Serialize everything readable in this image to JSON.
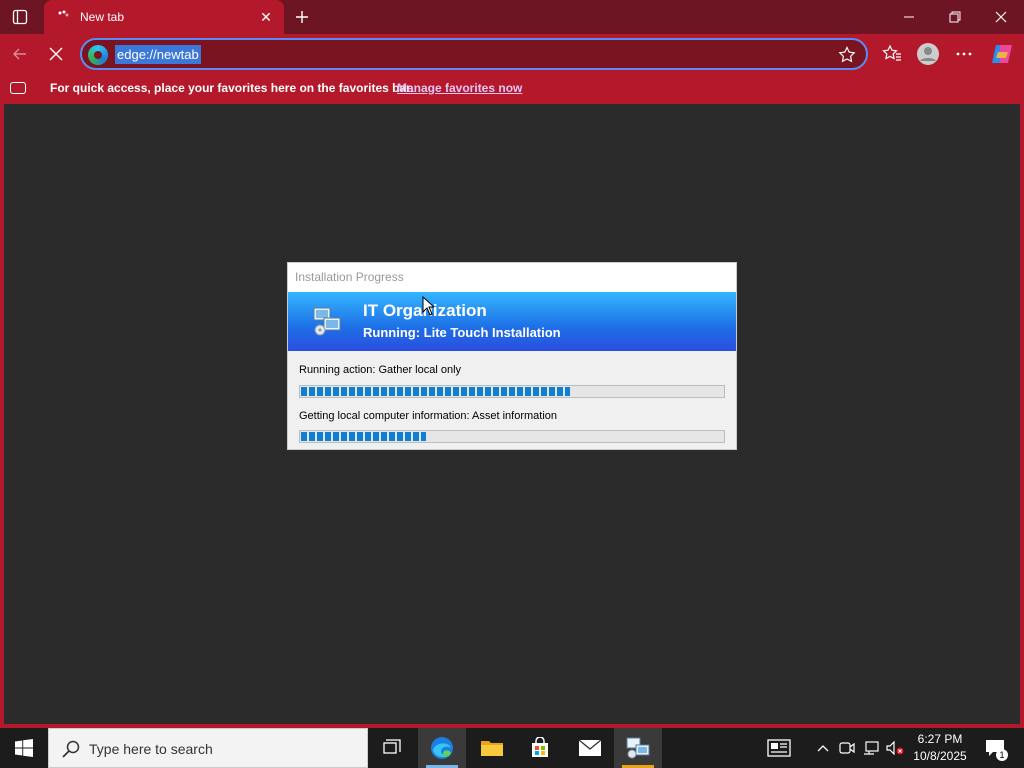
{
  "browser": {
    "tab": {
      "title": "New tab"
    },
    "address": {
      "url": "edge://newtab"
    },
    "favorites_bar": {
      "message": "For quick access, place your favorites here on the favorites bar.",
      "link": "Manage favorites now"
    },
    "theme_color": "#b3192a"
  },
  "dialog": {
    "title": "Installation Progress",
    "organization": "IT Organization",
    "subtitle": "Running: Lite Touch Installation",
    "action_label": "Running action: Gather local only",
    "action_progress_pct": 64,
    "detail_label": "Getting local computer information: Asset information",
    "detail_progress_pct": 30
  },
  "taskbar": {
    "search_placeholder": "Type here to search",
    "time": "6:27 PM",
    "date": "10/8/2025",
    "notification_count": "1",
    "apps": [
      "task-view-icon",
      "edge-icon",
      "file-explorer-icon",
      "store-icon",
      "mail-icon",
      "deployment-icon"
    ]
  }
}
